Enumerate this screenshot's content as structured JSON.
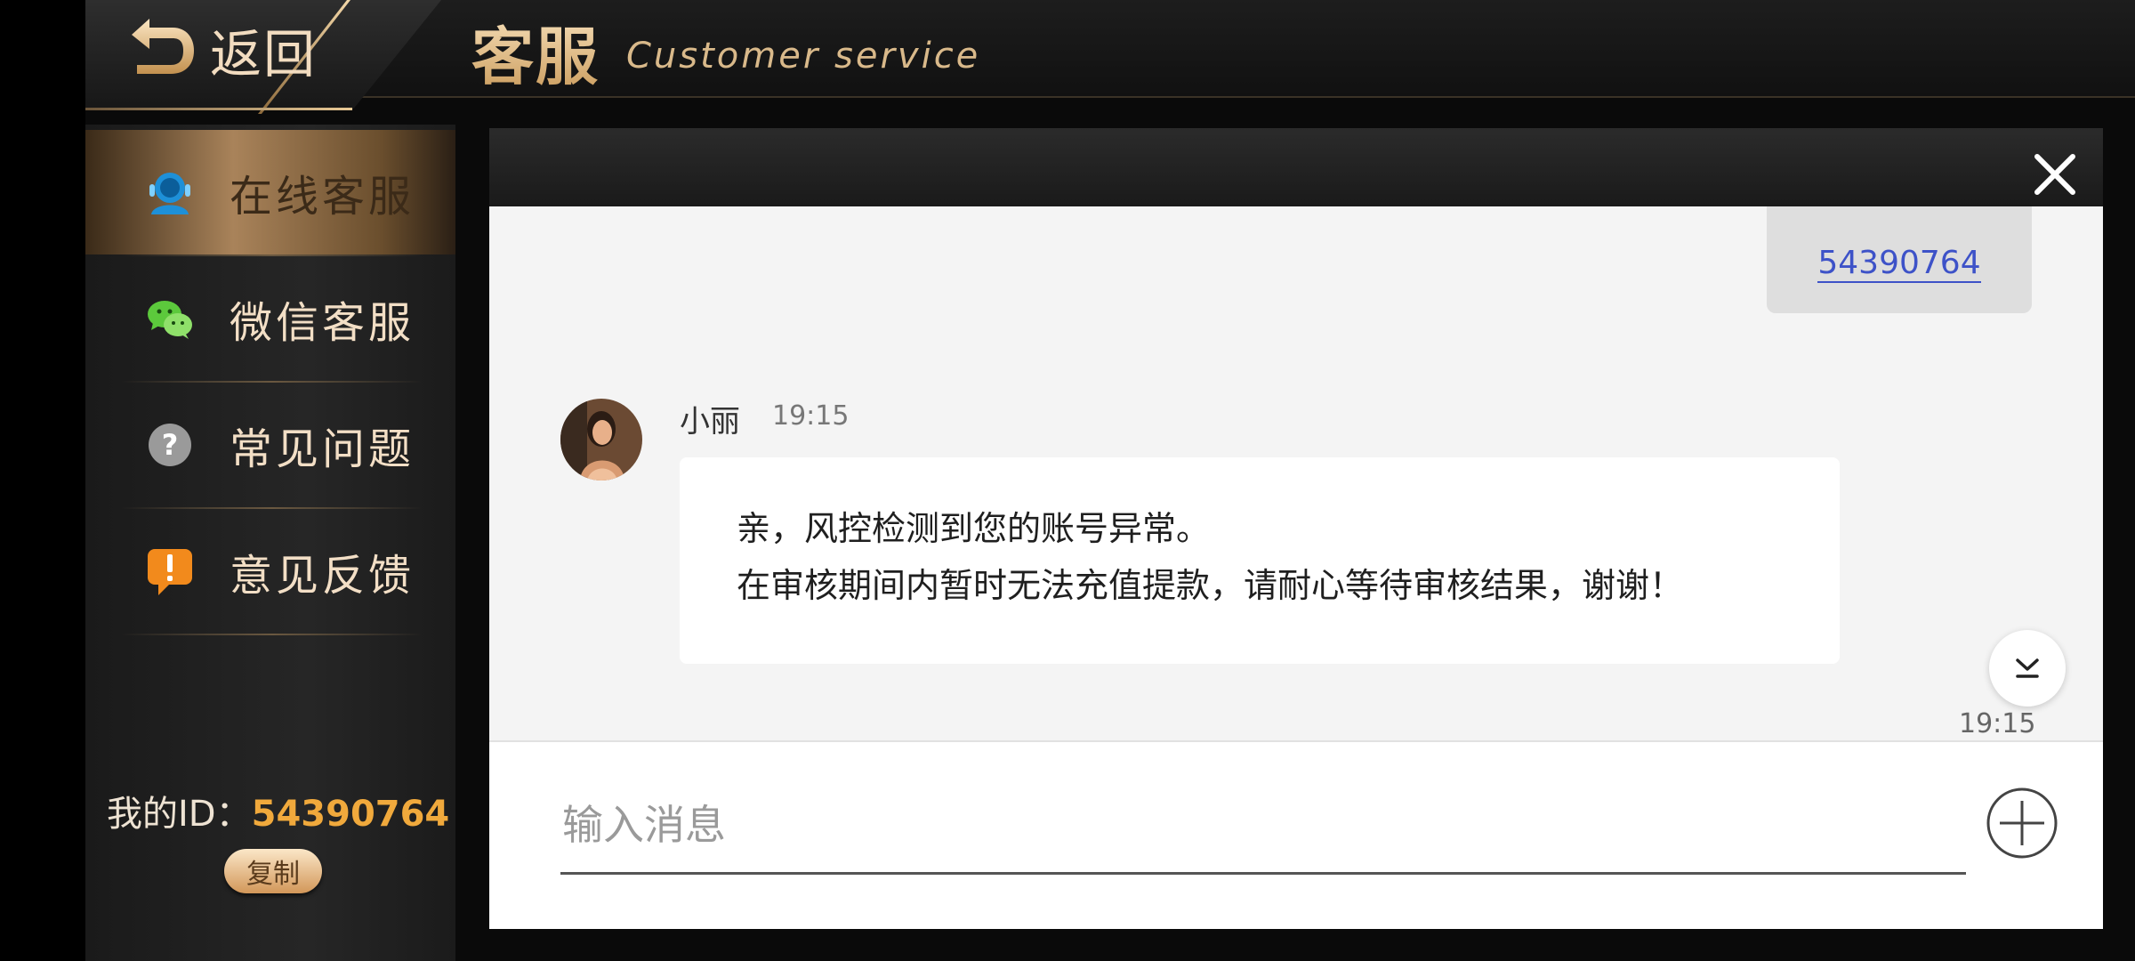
{
  "header": {
    "back_label": "返回",
    "title_cn": "客服",
    "title_en": "Customer service"
  },
  "sidebar": {
    "items": [
      {
        "label": "在线客服",
        "icon": "user-headset-icon",
        "active": true
      },
      {
        "label": "微信客服",
        "icon": "wechat-icon",
        "active": false
      },
      {
        "label": "常见问题",
        "icon": "question-icon",
        "active": false
      },
      {
        "label": "意见反馈",
        "icon": "feedback-exclamation-icon",
        "active": false
      }
    ],
    "my_id_label": "我的ID：",
    "my_id_value": "54390764",
    "copy_label": "复制"
  },
  "chat": {
    "sent_message": "54390764",
    "agent": {
      "name": "小丽",
      "time": "19:15",
      "lines": [
        "亲，风控检测到您的账号异常。",
        "在审核期间内暂时无法充值提款，请耐心等待审核结果，谢谢！"
      ]
    },
    "bottom_time": "19:15",
    "input_placeholder": "输入消息",
    "input_value": ""
  },
  "colors": {
    "accent_gold": "#e6c08a",
    "id_orange": "#f0a93c",
    "link_blue": "#3d52c8"
  }
}
